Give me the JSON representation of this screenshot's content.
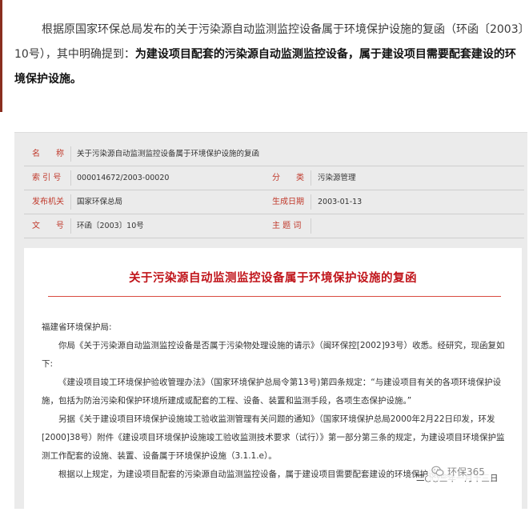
{
  "intro": {
    "lead": "根据原国家环保总局发布的关于污染源自动监测监控设备属于环境保护设施的复函（环函〔2003〕10号），其中明确提到：",
    "emphasis": "为建设项目配套的污染源自动监测监控设备，属于建设项目需要配套建设的环境保护设施。"
  },
  "meta": {
    "name_label": "名　　称",
    "name_value": "关于污染源自动监测监控设备属于环境保护设施的复函",
    "index_label": "索 引 号",
    "index_value": "000014672/2003-00020",
    "category_label": "分　　类",
    "category_value": "污染源管理",
    "issuer_label": "发布机关",
    "issuer_value": "国家环保总局",
    "date_label": "生成日期",
    "date_value": "2003-01-13",
    "docno_label": "文　　号",
    "docno_value": "环函〔2003〕10号",
    "keywords_label": "主 题 词",
    "keywords_value": ""
  },
  "doc": {
    "title": "关于污染源自动监测监控设备属于环境保护设施的复函",
    "salutation": "福建省环境保护局:",
    "para1": "你局《关于污染源自动监测监控设备是否属于污染物处理设施的请示》（闽环保控[2002]93号）收悉。经研究，现函复如下:",
    "para2": "《建设项目竣工环境保护验收管理办法》（国家环境保护总局令第13号)第四条规定：“与建设项目有关的各项环境保护设施，包括为防治污染和保护环境所建成或配套的工程、设备、装置和监测手段，各项生态保护设施。”",
    "para3": "另据《关于建设项目环境保护设施竣工验收监测管理有关问题的通知》（国家环境保护总局2000年2月22日印发，环发[2000]38号）附件《建设项目环境保护设施竣工验收监测技术要求（试行）》第一部分第三条的规定，为建设项目环境保护监测工作配套的设施、装置、设备属于环境保护设施（3.1.1.e）。",
    "para4": "根据以上规定，为建设项目配套的污染源自动监测监控设备，属于建设项目需要配套建设的环境保护设施。",
    "date": "二○○三年一月十三日"
  },
  "watermark": {
    "text": "环保365",
    "icon": "wechat-icon"
  },
  "colors": {
    "accent_red": "#c0141a",
    "label_red": "#c0392b",
    "panel_gray": "#ebebeb"
  }
}
